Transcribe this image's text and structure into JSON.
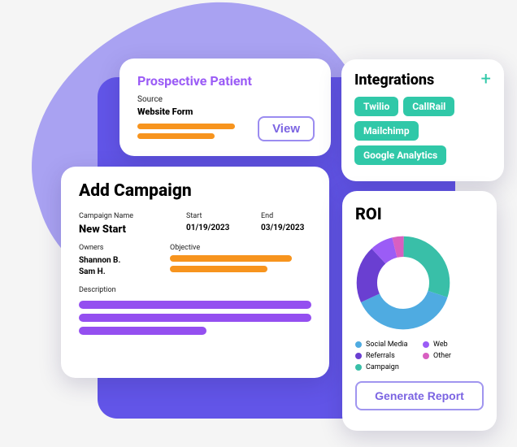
{
  "prospective": {
    "title": "Prospective Patient",
    "source_label": "Source",
    "source_value": "Website Form",
    "view_label": "View"
  },
  "campaign": {
    "title": "Add Campaign",
    "name_label": "Campaign Name",
    "name_value": "New Start",
    "start_label": "Start",
    "start_value": "01/19/2023",
    "end_label": "End",
    "end_value": "03/19/2023",
    "owners_label": "Owners",
    "owner1": "Shannon B.",
    "owner2": "Sam H.",
    "objective_label": "Objective",
    "description_label": "Description"
  },
  "integrations": {
    "title": "Integrations",
    "items": [
      "Twilio",
      "CallRail",
      "Mailchimp",
      "Google Analytics"
    ]
  },
  "roi": {
    "title": "ROI",
    "legend": [
      {
        "label": "Social Media",
        "color": "#4fabe1"
      },
      {
        "label": "Web",
        "color": "#9b5cf6"
      },
      {
        "label": "Referrals",
        "color": "#6a3fd1"
      },
      {
        "label": "Other",
        "color": "#d85fc1"
      },
      {
        "label": "Campaign",
        "color": "#39bfa8"
      }
    ],
    "generate_label": "Generate Report"
  },
  "chart_data": {
    "type": "pie",
    "title": "ROI",
    "series": [
      {
        "name": "Social Media",
        "value": 38,
        "color": "#4fabe1"
      },
      {
        "name": "Web",
        "value": 8,
        "color": "#9b5cf6"
      },
      {
        "name": "Referrals",
        "value": 20,
        "color": "#6a3fd1"
      },
      {
        "name": "Other",
        "value": 4,
        "color": "#d85fc1"
      },
      {
        "name": "Campaign",
        "value": 30,
        "color": "#39bfa8"
      }
    ],
    "donut": true
  }
}
